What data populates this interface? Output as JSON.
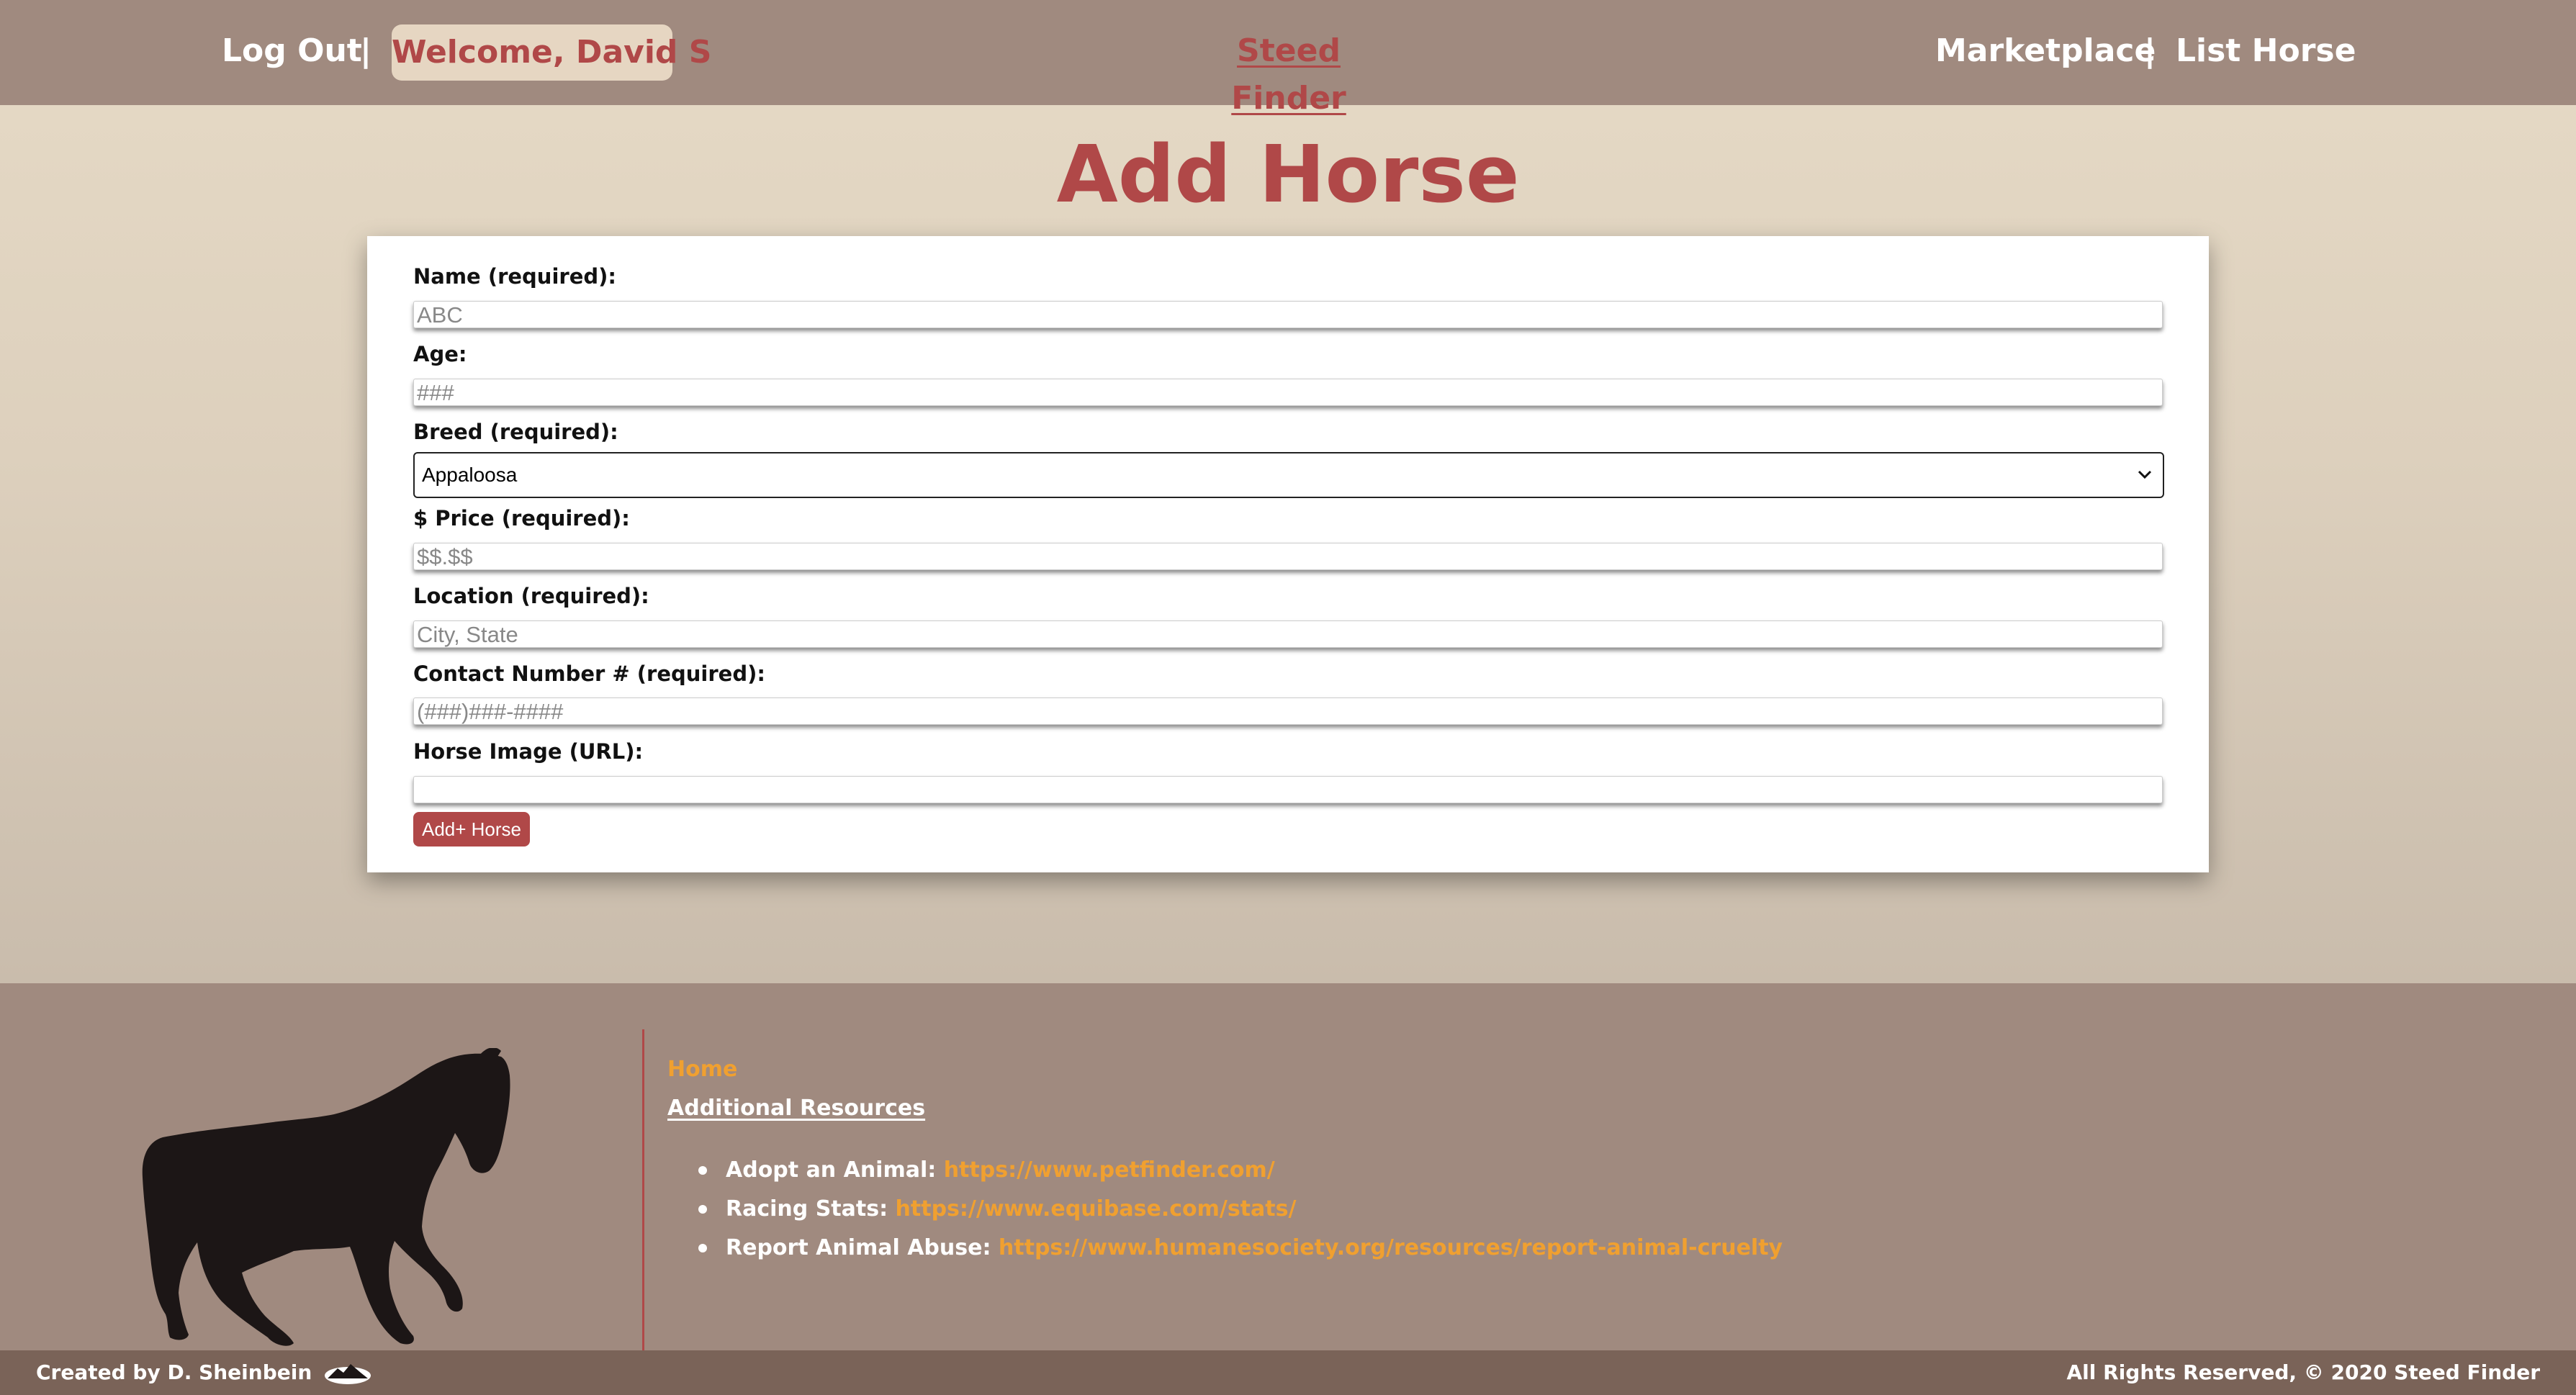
{
  "header": {
    "logout": "Log Out",
    "separator": "|",
    "welcome": "Welcome, David S",
    "brand": "Steed Finder",
    "marketplace": "Marketplace",
    "list_horse": "List Horse"
  },
  "page_title": "Add Horse",
  "form": {
    "name_label": "Name (required):",
    "name_placeholder": "ABC",
    "age_label": "Age:",
    "age_placeholder": "###",
    "breed_label": "Breed (required):",
    "breed_selected": "Appaloosa",
    "price_label": "$ Price (required):",
    "price_placeholder": "$$.$$",
    "location_label": "Location (required):",
    "location_placeholder": "City, State",
    "contact_label": "Contact Number # (required):",
    "contact_placeholder": "(###)###-####",
    "image_label": "Horse Image (URL):",
    "image_placeholder": "",
    "submit_label": "Add+ Horse"
  },
  "footer": {
    "home": "Home",
    "resources_heading": "Additional Resources",
    "resources": [
      {
        "label": "Adopt an Animal: ",
        "url": "https://www.petfinder.com/"
      },
      {
        "label": "Racing Stats: ",
        "url": "https://www.equibase.com/stats/"
      },
      {
        "label": "Report Animal Abuse: ",
        "url": "https://www.humanesociety.org/resources/report-animal-cruelty"
      }
    ],
    "credit": "Created by D. Sheinbein",
    "rights": "All Rights Reserved, © 2020 Steed Finder"
  },
  "colors": {
    "header_bg": "#a08a7f",
    "accent": "#b04848",
    "link": "#f0a030",
    "bottom_bar": "#7a6358"
  }
}
